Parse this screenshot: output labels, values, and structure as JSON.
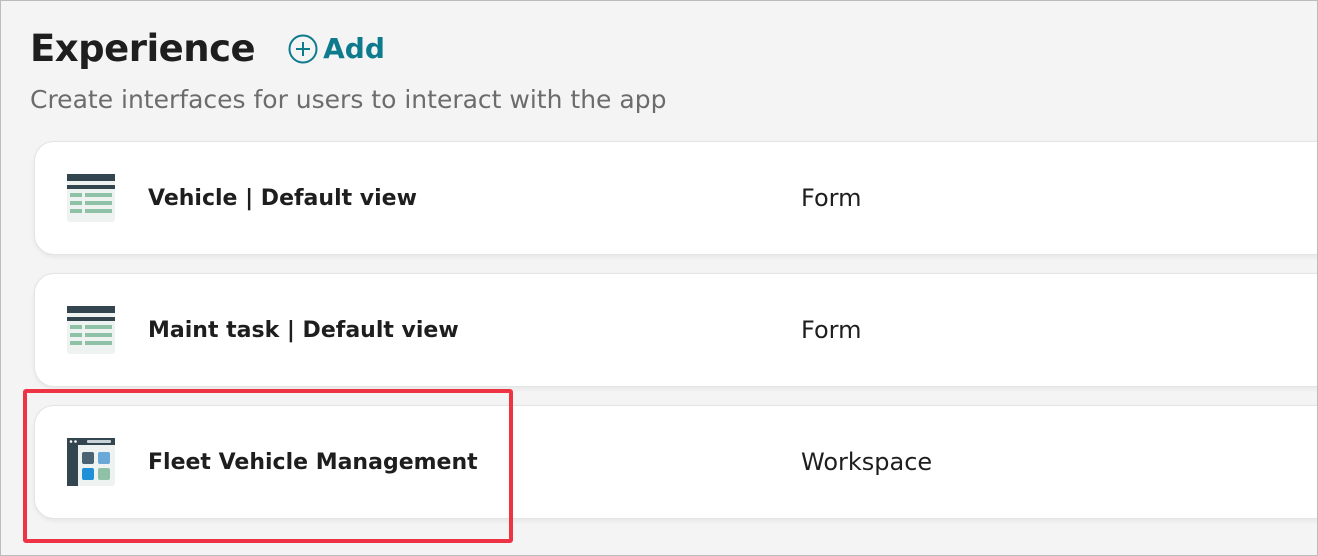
{
  "header": {
    "title": "Experience",
    "add_label": "Add",
    "subtitle": "Create interfaces for users to interact with the app"
  },
  "experiences": [
    {
      "name": "Vehicle | Default view",
      "type": "Form",
      "icon": "form-view-icon"
    },
    {
      "name": "Maint task | Default view",
      "type": "Form",
      "icon": "form-view-icon"
    },
    {
      "name": "Fleet Vehicle Management",
      "type": "Workspace",
      "icon": "workspace-icon"
    }
  ],
  "colors": {
    "accent": "#0e7a8d",
    "highlight": "#ee3344",
    "background": "#f4f4f4",
    "icon_dark": "#33464f",
    "icon_green": "#8fc1a6",
    "icon_blue": "#1e90d8"
  }
}
